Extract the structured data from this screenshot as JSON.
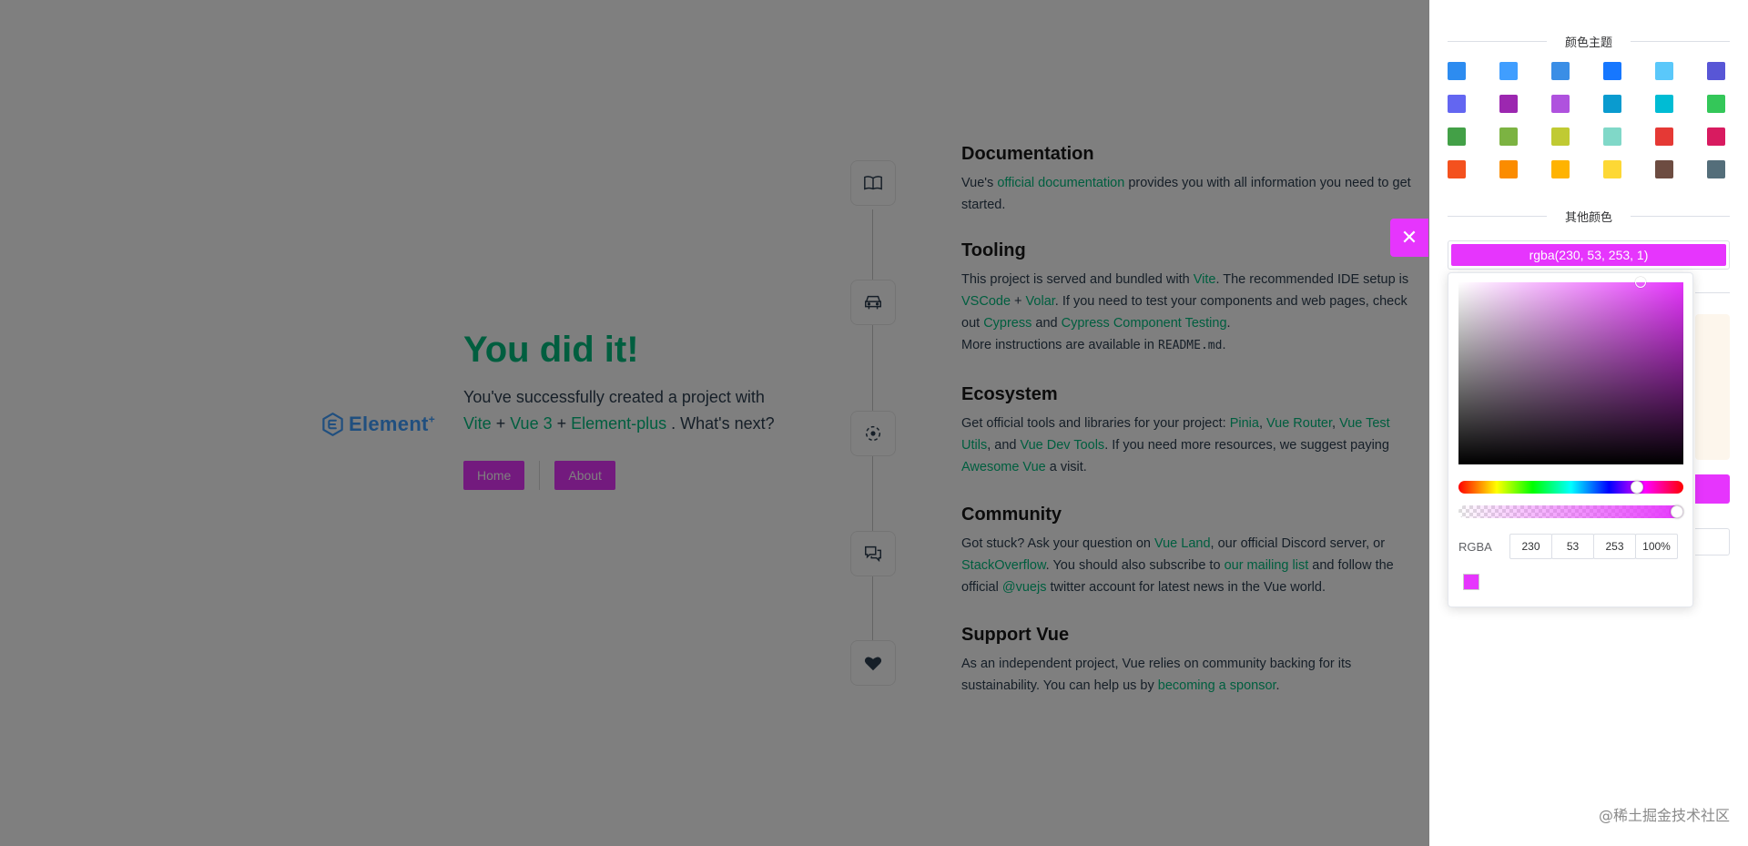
{
  "logo": {
    "text": "Element",
    "sup": "+"
  },
  "hero": {
    "title": "You did it!",
    "sub_prefix": "You've successfully created a project with",
    "link_vite": "Vite",
    "plus1": " + ",
    "link_vue3": "Vue 3",
    "plus2": " + ",
    "link_element": "Element-plus",
    "sub_suffix": " . What's next?",
    "nav": {
      "home": "Home",
      "about": "About"
    }
  },
  "items": [
    {
      "title": "Documentation",
      "icon": "book-icon"
    },
    {
      "title": "Tooling",
      "icon": "tools-icon"
    },
    {
      "title": "Ecosystem",
      "icon": "ecosystem-icon"
    },
    {
      "title": "Community",
      "icon": "community-icon"
    },
    {
      "title": "Support Vue",
      "icon": "heart-icon"
    }
  ],
  "doc": {
    "t1": "Vue's ",
    "a1": "official documentation",
    "t2": " provides you with all information you need to get started."
  },
  "tooling": {
    "t1": "This project is served and bundled with ",
    "a1": "Vite",
    "t2": ". The recommended IDE setup is ",
    "a2": "VSCode",
    "t3": " + ",
    "a3": "Volar",
    "t4": ". If you need to test your components and web pages, check out ",
    "a4": "Cypress",
    "t5": " and ",
    "a5": "Cypress Component Testing",
    "t6": ".",
    "t7": "More instructions are available in ",
    "code": "README.md",
    "t8": "."
  },
  "eco": {
    "t1": "Get official tools and libraries for your project: ",
    "a1": "Pinia",
    "t2": ", ",
    "a2": "Vue Router",
    "t3": ", ",
    "a3": "Vue Test Utils",
    "t4": ", and ",
    "a4": "Vue Dev Tools",
    "t5": ". If you need more resources, we suggest paying ",
    "a5": "Awesome Vue",
    "t6": " a visit."
  },
  "community": {
    "t1": "Got stuck? Ask your question on ",
    "a1": "Vue Land",
    "t2": ", our official Discord server, or ",
    "a2": "StackOverflow",
    "t3": ". You should also subscribe to ",
    "a3": "our mailing list",
    "t4": " and follow the official ",
    "a4": "@vuejs",
    "t5": " twitter account for latest news in the Vue world."
  },
  "support": {
    "t1": "As an independent project, Vue relies on community backing for its sustainability. You can help us by ",
    "a1": "becoming a sponsor",
    "t2": "."
  },
  "drawer": {
    "theme_title": "颜色主题",
    "other_title": "其他颜色",
    "current_value": "rgba(230, 53, 253, 1)",
    "close_icon": "close-icon",
    "swatches": [
      "#2d8cf0",
      "#409eff",
      "#3a8ee6",
      "#1677ff",
      "#5ac8fa",
      "#5856d6",
      "#6366f1",
      "#9c27b0",
      "#af52de",
      "#0a9bcf",
      "#00bcd4",
      "#34c759",
      "#43a047",
      "#7cb342",
      "#c0ca33",
      "#80d8c8",
      "#e53935",
      "#d81b60",
      "#f4511e",
      "#fb8c00",
      "#ffb300",
      "#fdd835",
      "#6d4c41",
      "#546e7a"
    ]
  },
  "picker": {
    "rgba_label": "RGBA",
    "r": "230",
    "g": "53",
    "b": "253",
    "a": "100%",
    "hue_fraction": 0.81,
    "alpha_fraction": 1.0
  },
  "watermark": "@稀土掘金技术社区",
  "colors": {
    "accent": "#e635fd",
    "link": "#00bd7e",
    "logo": "#409eff"
  }
}
